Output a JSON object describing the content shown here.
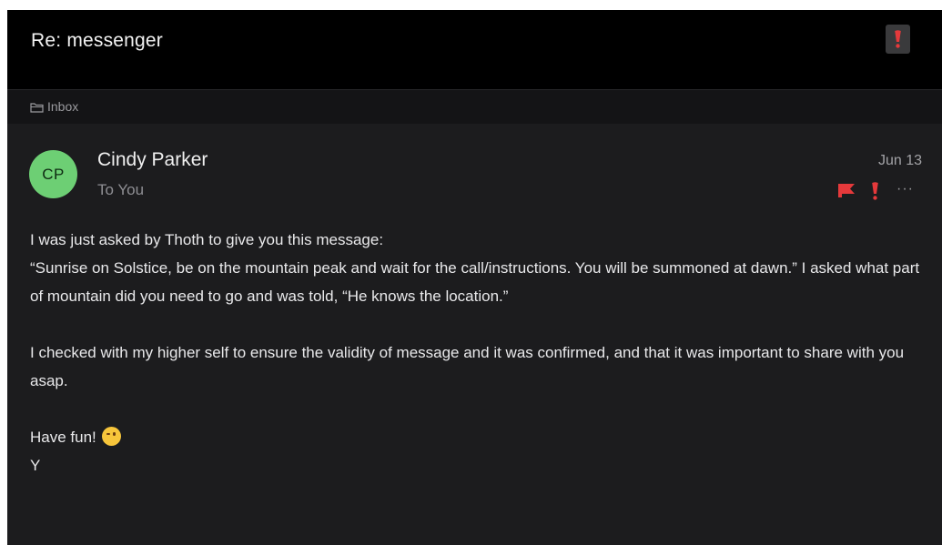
{
  "header": {
    "subject": "Re: messenger",
    "important_icon": "exclamation-icon",
    "accent_color": "#e5393b"
  },
  "folder": {
    "icon": "folder-icon",
    "label": "Inbox"
  },
  "message": {
    "avatar_initials": "CP",
    "avatar_color": "#6dcf74",
    "sender": "Cindy Parker",
    "recipient": "To You",
    "date": "Jun 13",
    "status_icons": [
      "flag-icon",
      "exclamation-icon",
      "more-icon"
    ],
    "more_label": "···",
    "body": [
      "I was just asked by Thoth to give you this message:",
      "“Sunrise on Solstice, be on the mountain peak and wait for the call/instructions.  You will be summoned at dawn.”  I asked what part of mountain did you need to go and was told, “He knows the location.”",
      "I checked with my higher self to ensure the validity of message and it was confirmed, and that it was important to share with you asap.",
      "Have fun!",
      "Y"
    ],
    "emoji": "winking-face-icon"
  }
}
